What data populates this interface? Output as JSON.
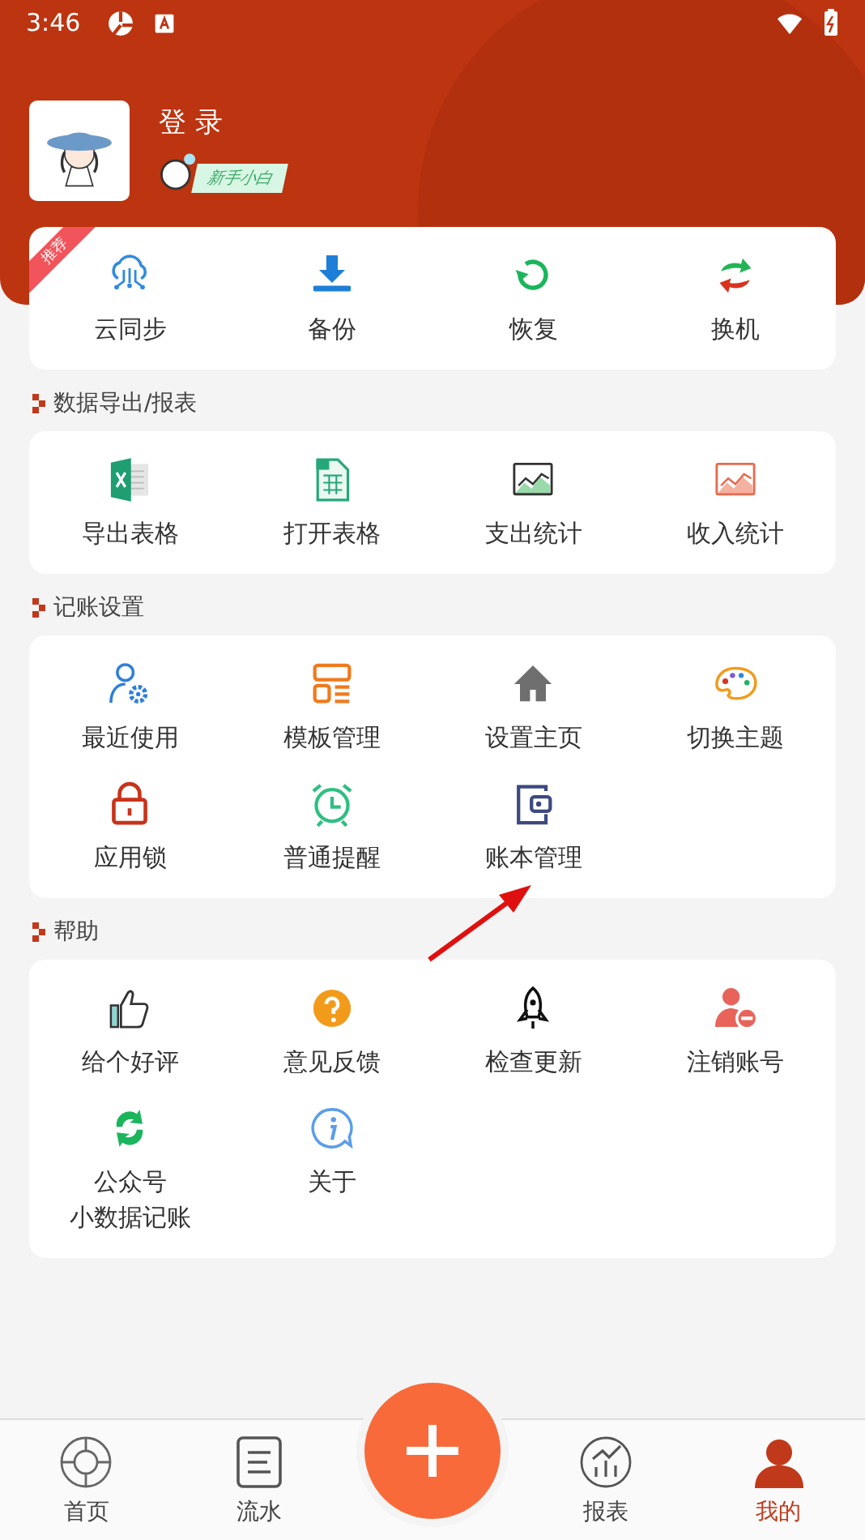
{
  "status_bar": {
    "time": "3:46"
  },
  "profile": {
    "name": "登 录",
    "level_badge": "新手小白"
  },
  "quick_actions": {
    "ribbon": "推荐",
    "items": [
      {
        "label": "云同步",
        "kind": "cloud"
      },
      {
        "label": "备份",
        "kind": "download"
      },
      {
        "label": "恢复",
        "kind": "refresh"
      },
      {
        "label": "换机",
        "kind": "swap"
      }
    ]
  },
  "sections": [
    {
      "title": "数据导出/报表",
      "items": [
        {
          "label": "导出表格",
          "kind": "excel"
        },
        {
          "label": "打开表格",
          "kind": "sheet"
        },
        {
          "label": "支出统计",
          "kind": "expense"
        },
        {
          "label": "收入统计",
          "kind": "income"
        }
      ]
    },
    {
      "title": "记账设置",
      "items": [
        {
          "label": "最近使用",
          "kind": "recent"
        },
        {
          "label": "模板管理",
          "kind": "template"
        },
        {
          "label": "设置主页",
          "kind": "home"
        },
        {
          "label": "切换主题",
          "kind": "theme"
        },
        {
          "label": "应用锁",
          "kind": "lock"
        },
        {
          "label": "普通提醒",
          "kind": "alarm"
        },
        {
          "label": "账本管理",
          "kind": "wallet"
        }
      ]
    },
    {
      "title": "帮助",
      "items": [
        {
          "label": "给个好评",
          "kind": "rate"
        },
        {
          "label": "意见反馈",
          "kind": "feedback"
        },
        {
          "label": "检查更新",
          "kind": "update"
        },
        {
          "label": "注销账号",
          "kind": "unregister"
        },
        {
          "label": "公众号",
          "sublabel": "小数据记账",
          "kind": "wechat"
        },
        {
          "label": "关于",
          "kind": "about"
        }
      ]
    }
  ],
  "bottom_nav": {
    "items": [
      {
        "label": "首页",
        "kind": "home",
        "selected": false
      },
      {
        "label": "流水",
        "kind": "list",
        "selected": false
      },
      {
        "label": "报表",
        "kind": "report",
        "selected": false
      },
      {
        "label": "我的",
        "kind": "mine",
        "selected": true
      }
    ]
  }
}
